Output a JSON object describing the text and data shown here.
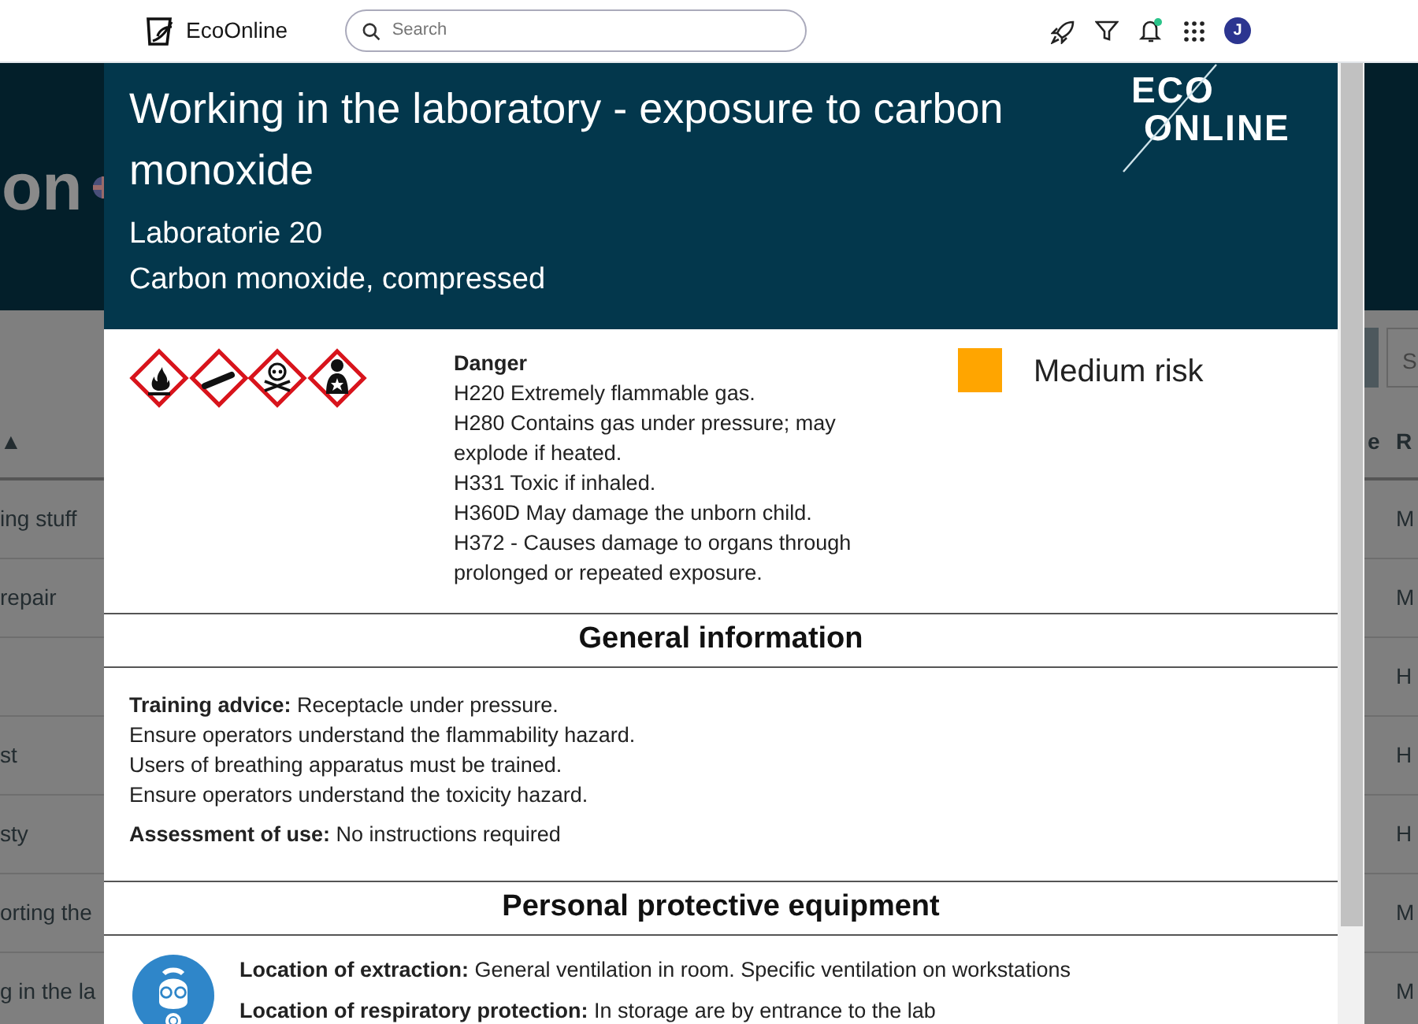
{
  "navbar": {
    "logo": "EcoOnline",
    "search": {
      "placeholder": "Search"
    },
    "avatar": "J",
    "notification": true
  },
  "background": {
    "heading_fragment": "on",
    "search_fragment": "S",
    "columns": [
      "▲",
      "e",
      "R"
    ],
    "rows": [
      {
        "column_1": "ing stuff",
        "column_2": "M"
      },
      {
        "column_1": "repair",
        "column_2": "M"
      },
      {
        "column_1": "",
        "column_2": "H"
      },
      {
        "column_1": "st",
        "column_2": "H"
      },
      {
        "column_1": "sty",
        "column_2": "H"
      },
      {
        "column_1": "orting the",
        "column_2": "M"
      },
      {
        "column_1": "g in the la",
        "column_2": "M"
      }
    ]
  },
  "modal": {
    "title": "Working in the laboratory - exposure to carbon monoxide",
    "subtitles": [
      "Laboratorie 20",
      "Carbon monoxide, compressed"
    ],
    "logo_lines": [
      "ECO",
      "ONLINE"
    ],
    "hazard": {
      "pictograms": [
        {
          "kind": "flame"
        },
        {
          "kind": "gas-cylinder"
        },
        {
          "kind": "skull"
        },
        {
          "kind": "health-hazard"
        }
      ],
      "signal_word": "Danger",
      "statements": [
        "H220 Extremely flammable gas.",
        "H280 Contains gas under pressure; may explode if heated.",
        "H331 Toxic if inhaled.",
        "H360D May damage the unborn child.",
        "H372 - Causes damage to organs through prolonged or repeated exposure."
      ],
      "risk": {
        "label": "Medium risk",
        "color": "#ffa500"
      }
    },
    "sections": [
      {
        "heading": "General information",
        "paragraphs": [
          "**Training advice:** Receptacle under pressure.\nEnsure operators understand the flammability hazard.\nUsers of breathing apparatus must be trained.\nEnsure operators understand the toxicity hazard.",
          "**Assessment of use:** No instructions required"
        ]
      },
      {
        "heading": "Personal protective equipment",
        "pictograms": [
          {
            "kind": "respirator"
          }
        ],
        "paragraphs": [
          "**Location of extraction:** General ventilation in room. Specific ventilation on workstations",
          "**Location of respiratory protection:** In storage are by entrance to the lab"
        ]
      }
    ]
  }
}
